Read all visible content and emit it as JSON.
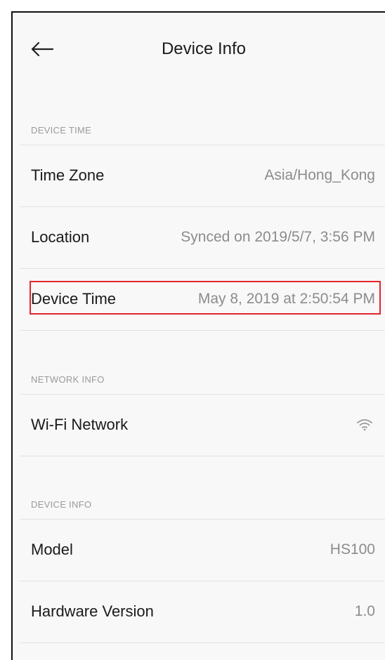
{
  "header": {
    "title": "Device Info",
    "back_icon": "arrow-left-icon"
  },
  "sections": {
    "device_time": {
      "header": "DEVICE TIME",
      "time_zone": {
        "label": "Time Zone",
        "value": "Asia/Hong_Kong"
      },
      "location": {
        "label": "Location",
        "value": "Synced on 2019/5/7, 3:56 PM"
      },
      "device_time": {
        "label": "Device Time",
        "value": "May 8, 2019 at 2:50:54 PM"
      }
    },
    "network_info": {
      "header": "NETWORK INFO",
      "wifi": {
        "label": "Wi-Fi Network",
        "icon": "wifi-icon"
      }
    },
    "device_info": {
      "header": "DEVICE INFO",
      "model": {
        "label": "Model",
        "value": "HS100"
      },
      "hardware_version": {
        "label": "Hardware Version",
        "value": "1.0"
      }
    }
  },
  "colors": {
    "highlight": "#e2232e",
    "background": "#f8f8f8",
    "label_text": "#1a1a1a",
    "value_text": "#8c8c8c",
    "section_header": "#9a9a9a"
  }
}
